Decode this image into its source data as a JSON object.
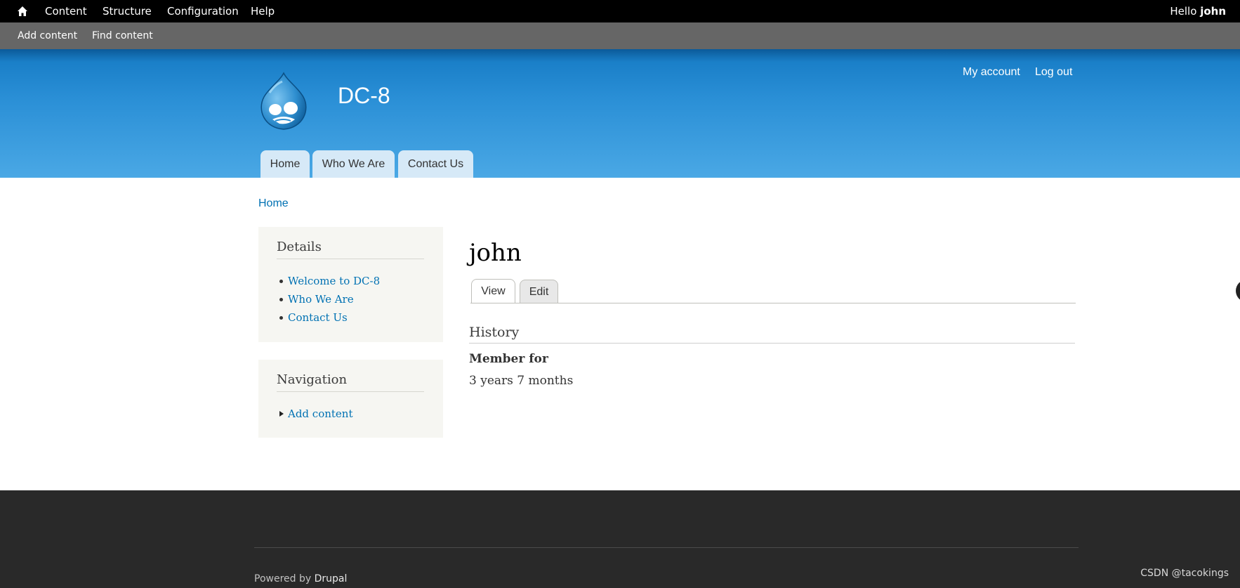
{
  "toolbar": {
    "items": [
      "Content",
      "Structure",
      "Configuration",
      "Help"
    ],
    "hello_prefix": "Hello",
    "username": "john"
  },
  "shortcuts": [
    "Add content",
    "Find content"
  ],
  "header": {
    "site_name": "DC-8",
    "secondary_menu": [
      "My account",
      "Log out"
    ],
    "main_menu": [
      "Home",
      "Who We Are",
      "Contact Us"
    ]
  },
  "breadcrumb": "Home",
  "sidebar": {
    "details": {
      "title": "Details",
      "links": [
        "Welcome to DC-8",
        "Who We Are",
        "Contact Us"
      ]
    },
    "navigation": {
      "title": "Navigation",
      "links": [
        "Add content"
      ]
    }
  },
  "main": {
    "title": "john",
    "tabs": [
      "View",
      "Edit"
    ],
    "active_tab": "View",
    "section_title": "History",
    "field_label": "Member for",
    "field_value": "3 years 7 months"
  },
  "footer": {
    "powered_prefix": "Powered by",
    "powered_link": "Drupal",
    "watermark": "CSDN @tacokings"
  },
  "colors": {
    "toolbar_bg": "#000000",
    "shortcuts_bg": "#666666",
    "header_blue": "#2a8fd6",
    "link": "#0071b3",
    "sidebar_bg": "#f6f6f2",
    "footer_bg": "#292929"
  },
  "icons": {
    "toolbar_home": "home-icon",
    "logo": "drupal-drop-logo",
    "nav_arrow": "triangle-right-icon"
  }
}
